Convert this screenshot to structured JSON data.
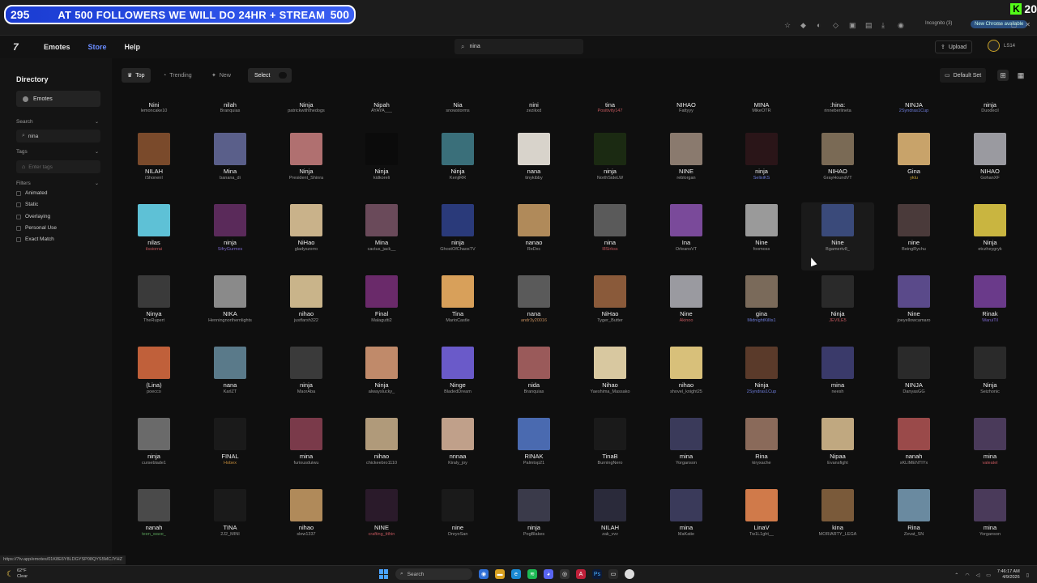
{
  "overlay": {
    "left_count": "295",
    "message": "AT 500 FOLLOWERS WE WILL DO 24HR + STREAM",
    "right_count": "500",
    "kick_count": "20"
  },
  "browser": {
    "incognito_label": "Incognito (3)",
    "new_chrome_label": "New Chrome available",
    "status_url": "https://7tv.app/emotes/01K8E6Y8LDGYSP08QYS5MCJYHZ"
  },
  "header": {
    "logo": "7",
    "nav": [
      "Emotes",
      "Store",
      "Help"
    ],
    "search_value": "nina",
    "upload_label": "Upload",
    "username": "LS14"
  },
  "sidebar": {
    "title": "Directory",
    "emotes_label": "Emotes",
    "search_label": "Search",
    "search_value": "nina",
    "tags_label": "Tags",
    "tags_placeholder": "Enter tags",
    "filters_label": "Filters",
    "filters": [
      "Animated",
      "Static",
      "Overlaying",
      "Personal Use",
      "Exact Match"
    ]
  },
  "toolbar": {
    "top": "Top",
    "trending": "Trending",
    "new": "New",
    "select": "Select",
    "default_set": "Default Set"
  },
  "colors": {
    "accent": "#6a8cff",
    "banner_blue": "#2b50e6",
    "kick_green": "#53fc18"
  },
  "rows": [
    [
      {
        "name": "Nini",
        "author": "lemoncake10",
        "ac": "#999"
      },
      {
        "name": "nilah",
        "author": "Branquias",
        "ac": "#999"
      },
      {
        "name": "Ninja",
        "author": "patrickwiththedogs",
        "ac": "#999"
      },
      {
        "name": "Nipah",
        "author": "AYAYA___",
        "ac": "#999"
      },
      {
        "name": "Nia",
        "author": "snowstorms",
        "ac": "#999"
      },
      {
        "name": "nini",
        "author": "zezikxd",
        "ac": "#999"
      },
      {
        "name": "tina",
        "author": "Positivity147",
        "ac": "#c0565c"
      },
      {
        "name": "NIHAO",
        "author": "Fattyyy",
        "ac": "#999"
      },
      {
        "name": "MINA",
        "author": "MikeOTR",
        "ac": "#999"
      },
      {
        "name": ":hina:",
        "author": "rinneberlineta",
        "ac": "#999"
      },
      {
        "name": "NINJA",
        "author": "2Syndras1Cup",
        "ac": "#6c7bd8"
      },
      {
        "name": "ninja",
        "author": "Duodecil",
        "ac": "#999"
      }
    ],
    [
      {
        "name": "NILAH",
        "author": "iShonenI",
        "ac": "#999",
        "c": "#7a4a2b"
      },
      {
        "name": "Mina",
        "author": "banana_di",
        "ac": "#999",
        "c": "#5a5f8a"
      },
      {
        "name": "Ninja",
        "author": "President_Shinra",
        "ac": "#999",
        "c": "#b07070"
      },
      {
        "name": "Ninja",
        "author": "kidkoreli",
        "ac": "#999",
        "c": "#0b0b0b"
      },
      {
        "name": "Ninja",
        "author": "KenjiRR",
        "ac": "#999",
        "c": "#3a6f7a"
      },
      {
        "name": "nana",
        "author": "tinykibby",
        "ac": "#999",
        "c": "#d8d3cb"
      },
      {
        "name": "ninja",
        "author": "NorthSideLW",
        "ac": "#999",
        "c": "#1b2a12"
      },
      {
        "name": "NINE",
        "author": "reblorgan",
        "ac": "#999",
        "c": "#8a7a6e"
      },
      {
        "name": "ninja",
        "author": "SelixiKS",
        "ac": "#6c7bd8",
        "c": "#2a1518"
      },
      {
        "name": "NIHAO",
        "author": "GrayHoundVT",
        "ac": "#999",
        "c": "#7a6a55"
      },
      {
        "name": "Gina",
        "author": "yklu",
        "ac": "#c5a032",
        "c": "#c8a36a"
      },
      {
        "name": "NIHAO",
        "author": "GohanXF",
        "ac": "#999",
        "c": "#9a9aa0"
      }
    ],
    [
      {
        "name": "nilas",
        "author": "ilssiorrai",
        "ac": "#c0565c",
        "c": "#5ec1d6"
      },
      {
        "name": "ninja",
        "author": "SifryGurmes",
        "ac": "#7a66c9",
        "c": "#5a2a5a"
      },
      {
        "name": "NiHao",
        "author": "gladyszorro",
        "ac": "#999",
        "c": "#c9b28a"
      },
      {
        "name": "Mina",
        "author": "cactus_jack__",
        "ac": "#999",
        "c": "#6a4a5a"
      },
      {
        "name": "ninja",
        "author": "GhostOfChaosTV",
        "ac": "#999",
        "c": "#2a3a7a"
      },
      {
        "name": "nanao",
        "author": "ReDxc",
        "ac": "#999",
        "c": "#b08a5a"
      },
      {
        "name": "nina",
        "author": "l8Sirkss",
        "ac": "#c0565c",
        "c": "#5a5a5a"
      },
      {
        "name": "Ina",
        "author": "OrleansVT",
        "ac": "#999",
        "c": "#7a4a9a"
      },
      {
        "name": "Nine",
        "author": "foxmoss",
        "ac": "#999",
        "c": "#9a9a9a"
      },
      {
        "name": "Nine",
        "author": "Bgamertv8_",
        "ac": "#999",
        "c": "#3a4a7a"
      },
      {
        "name": "nine",
        "author": "BeingRychu",
        "ac": "#999",
        "c": "#4a3a3a"
      },
      {
        "name": "Ninja",
        "author": "etczheygryk",
        "ac": "#999",
        "c": "#c9b540"
      }
    ],
    [
      {
        "name": "Ninya",
        "author": "TheRupert",
        "ac": "#999",
        "c": "#3a3a3a"
      },
      {
        "name": "NIKA",
        "author": "Henningnorthernlights",
        "ac": "#999",
        "c": "#8a8a8a"
      },
      {
        "name": "nihao",
        "author": "justfarsh322",
        "ac": "#999",
        "c": "#c9b48a"
      },
      {
        "name": "Final",
        "author": "Malagutti2",
        "ac": "#999",
        "c": "#6a2a6a"
      },
      {
        "name": "Tina",
        "author": "MarioCastle",
        "ac": "#999",
        "c": "#d8a05a"
      },
      {
        "name": "nana",
        "author": "andr3y20016",
        "ac": "#c08a5a",
        "c": "#5a5a5a"
      },
      {
        "name": "NiHao",
        "author": "Tyger_Butter",
        "ac": "#999",
        "c": "#8a5a3a"
      },
      {
        "name": "Nine",
        "author": "Akinoo",
        "ac": "#c0565c",
        "c": "#9a9aa0"
      },
      {
        "name": "gina",
        "author": "MidnightKillis1",
        "ac": "#6c7bd8",
        "c": "#7a6a5a"
      },
      {
        "name": "Ninja",
        "author": "JEVILE5",
        "ac": "#c0565c",
        "c": "#2a2a2a"
      },
      {
        "name": "Nine",
        "author": "joeyellowcamaro",
        "ac": "#999",
        "c": "#5a4a8a"
      },
      {
        "name": "Rinak",
        "author": "WaruiTil",
        "ac": "#7a66c9",
        "c": "#6a3a8a"
      }
    ],
    [
      {
        "name": "(Lina)",
        "author": "poecco",
        "ac": "#999",
        "c": "#c0603a"
      },
      {
        "name": "nana",
        "author": "KarlZT",
        "ac": "#999",
        "c": "#5a7a8a"
      },
      {
        "name": "ninja",
        "author": "MaorAba",
        "ac": "#999",
        "c": "#3a3a3a"
      },
      {
        "name": "Ninja",
        "author": "alwayslucky_",
        "ac": "#999",
        "c": "#c08a6a"
      },
      {
        "name": "Ninge",
        "author": "BladedDream",
        "ac": "#999",
        "c": "#6a5ac9"
      },
      {
        "name": "nida",
        "author": "Branquias",
        "ac": "#999",
        "c": "#9a5a5a"
      },
      {
        "name": "Nihao",
        "author": "Yaeshima_Massako",
        "ac": "#999",
        "c": "#d8c8a0"
      },
      {
        "name": "nihao",
        "author": "shovel_knight25",
        "ac": "#999",
        "c": "#d8c07a"
      },
      {
        "name": "Ninja",
        "author": "2Syndras1Cup",
        "ac": "#6c7bd8",
        "c": "#5a3a2a"
      },
      {
        "name": "mina",
        "author": "neesh",
        "ac": "#999",
        "c": "#3a3a6a"
      },
      {
        "name": "NINJA",
        "author": "DanyasGG",
        "ac": "#999",
        "c": "#2a2a2a"
      },
      {
        "name": "Ninja",
        "author": "Seizhonic",
        "ac": "#999",
        "c": "#2a2a2a"
      }
    ],
    [
      {
        "name": "ninja",
        "author": "curseblade1",
        "ac": "#999",
        "c": "#6a6a6a"
      },
      {
        "name": "FINAL",
        "author": "Hobex",
        "ac": "#c08a3a",
        "c": "#1a1a1a"
      },
      {
        "name": "mina",
        "author": "furiousduiwu",
        "ac": "#999",
        "c": "#7a3a4a"
      },
      {
        "name": "nihao",
        "author": "chickeebro1110",
        "ac": "#999",
        "c": "#b09a7a"
      },
      {
        "name": "nnnaa",
        "author": "Kiraly_joy",
        "ac": "#999",
        "c": "#c0a08a"
      },
      {
        "name": "RINAK",
        "author": "Palmtop21",
        "ac": "#999",
        "c": "#4a6ab0"
      },
      {
        "name": "TinaB",
        "author": "BurningNero",
        "ac": "#999",
        "c": "#1a1a1a"
      },
      {
        "name": "mina",
        "author": "Yorganson",
        "ac": "#999",
        "c": "#3a3a5a"
      },
      {
        "name": "Rina",
        "author": "kiryxache",
        "ac": "#999",
        "c": "#8a6a5a"
      },
      {
        "name": "Nipaa",
        "author": "Evansfight",
        "ac": "#999",
        "c": "#c0a880"
      },
      {
        "name": "nanah",
        "author": "xKLIMENTIYx",
        "ac": "#999",
        "c": "#9a4a4a"
      },
      {
        "name": "mina",
        "author": "valeatel",
        "ac": "#c0565c",
        "c": "#4a3a5a"
      }
    ],
    [
      {
        "name": "nanah",
        "author": "teen_wave_",
        "ac": "#5aa05a",
        "c": "#4a4a4a"
      },
      {
        "name": "TINA",
        "author": "2J2_MINI",
        "ac": "#999",
        "c": "#1a1a1a"
      },
      {
        "name": "nihao",
        "author": "slew1337",
        "ac": "#999",
        "c": "#b08a5a"
      },
      {
        "name": "NINE",
        "author": "crafting_tithin",
        "ac": "#c0565c",
        "c": "#2a1a2a"
      },
      {
        "name": "nine",
        "author": "OnryoSan",
        "ac": "#999",
        "c": "#1a1a1a"
      },
      {
        "name": "ninja",
        "author": "PogBlakes",
        "ac": "#999",
        "c": "#3a3a4a"
      },
      {
        "name": "NILAH",
        "author": "zak_vvv",
        "ac": "#999",
        "c": "#2a2a3a"
      },
      {
        "name": "mina",
        "author": "MaKatie",
        "ac": "#999",
        "c": "#3a3a5a"
      },
      {
        "name": "LinaV",
        "author": "Tw1L1ght__",
        "ac": "#999",
        "c": "#d07a4a"
      },
      {
        "name": "kina",
        "author": "MORIARTY_LEGA",
        "ac": "#999",
        "c": "#7a5a3a"
      },
      {
        "name": "Rina",
        "author": "Zevat_SN",
        "ac": "#999",
        "c": "#6a8aa0"
      },
      {
        "name": "mina",
        "author": "Yorganson",
        "ac": "#999",
        "c": "#4a3a5a"
      }
    ]
  ],
  "taskbar": {
    "weather_temp": "62°F",
    "weather_desc": "Clear",
    "search_label": "Search",
    "time": "7:46:17 AM",
    "date": "4/9/2026"
  }
}
